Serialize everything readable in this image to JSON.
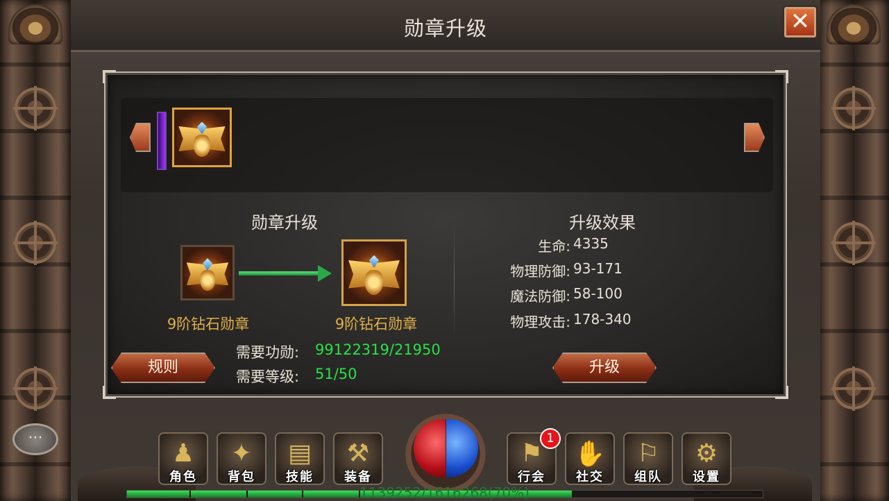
{
  "window": {
    "title": "勋章升级",
    "close_label": "✕"
  },
  "carousel": {
    "prev_arrow": "chevron-left-icon",
    "next_arrow": "chevron-right-icon"
  },
  "upgrade": {
    "section_title": "勋章升级",
    "current_medal_name": "9阶钻石勋章",
    "next_medal_name": "9阶钻石勋章",
    "requirements": [
      {
        "label": "需要功勋:",
        "value": "99122319/21950"
      },
      {
        "label": "需要等级:",
        "value": "51/50"
      }
    ],
    "rules_button": "规则"
  },
  "effects": {
    "section_title": "升级效果",
    "stats": [
      {
        "label": "生命:",
        "value": "4335"
      },
      {
        "label": "物理防御:",
        "value": "93-171"
      },
      {
        "label": "魔法防御:",
        "value": "58-100"
      },
      {
        "label": "物理攻击:",
        "value": "178-340"
      }
    ],
    "upgrade_button": "升级"
  },
  "bottom_bar": {
    "chat_label": "···",
    "left_buttons": [
      {
        "label": "角色",
        "icon": "character-icon",
        "glyph": "♟"
      },
      {
        "label": "背包",
        "icon": "bag-icon",
        "glyph": "✦"
      },
      {
        "label": "技能",
        "icon": "skill-book-icon",
        "glyph": "▤"
      },
      {
        "label": "装备",
        "icon": "hammer-icon",
        "glyph": "⚒"
      }
    ],
    "right_buttons": [
      {
        "label": "行会",
        "icon": "guild-banner-icon",
        "glyph": "⚑",
        "badge": "1"
      },
      {
        "label": "社交",
        "icon": "handshake-icon",
        "glyph": "✋"
      },
      {
        "label": "组队",
        "icon": "team-flag-icon",
        "glyph": "⚐"
      },
      {
        "label": "设置",
        "icon": "gear-icon",
        "glyph": "⚙"
      }
    ],
    "experience_text": "1139252/1616268(70%)",
    "experience_fraction": 0.7
  },
  "colors": {
    "requirement_value": "#28e04a",
    "medal_name": "#e0b049",
    "accent_button": "#8a2e14"
  }
}
